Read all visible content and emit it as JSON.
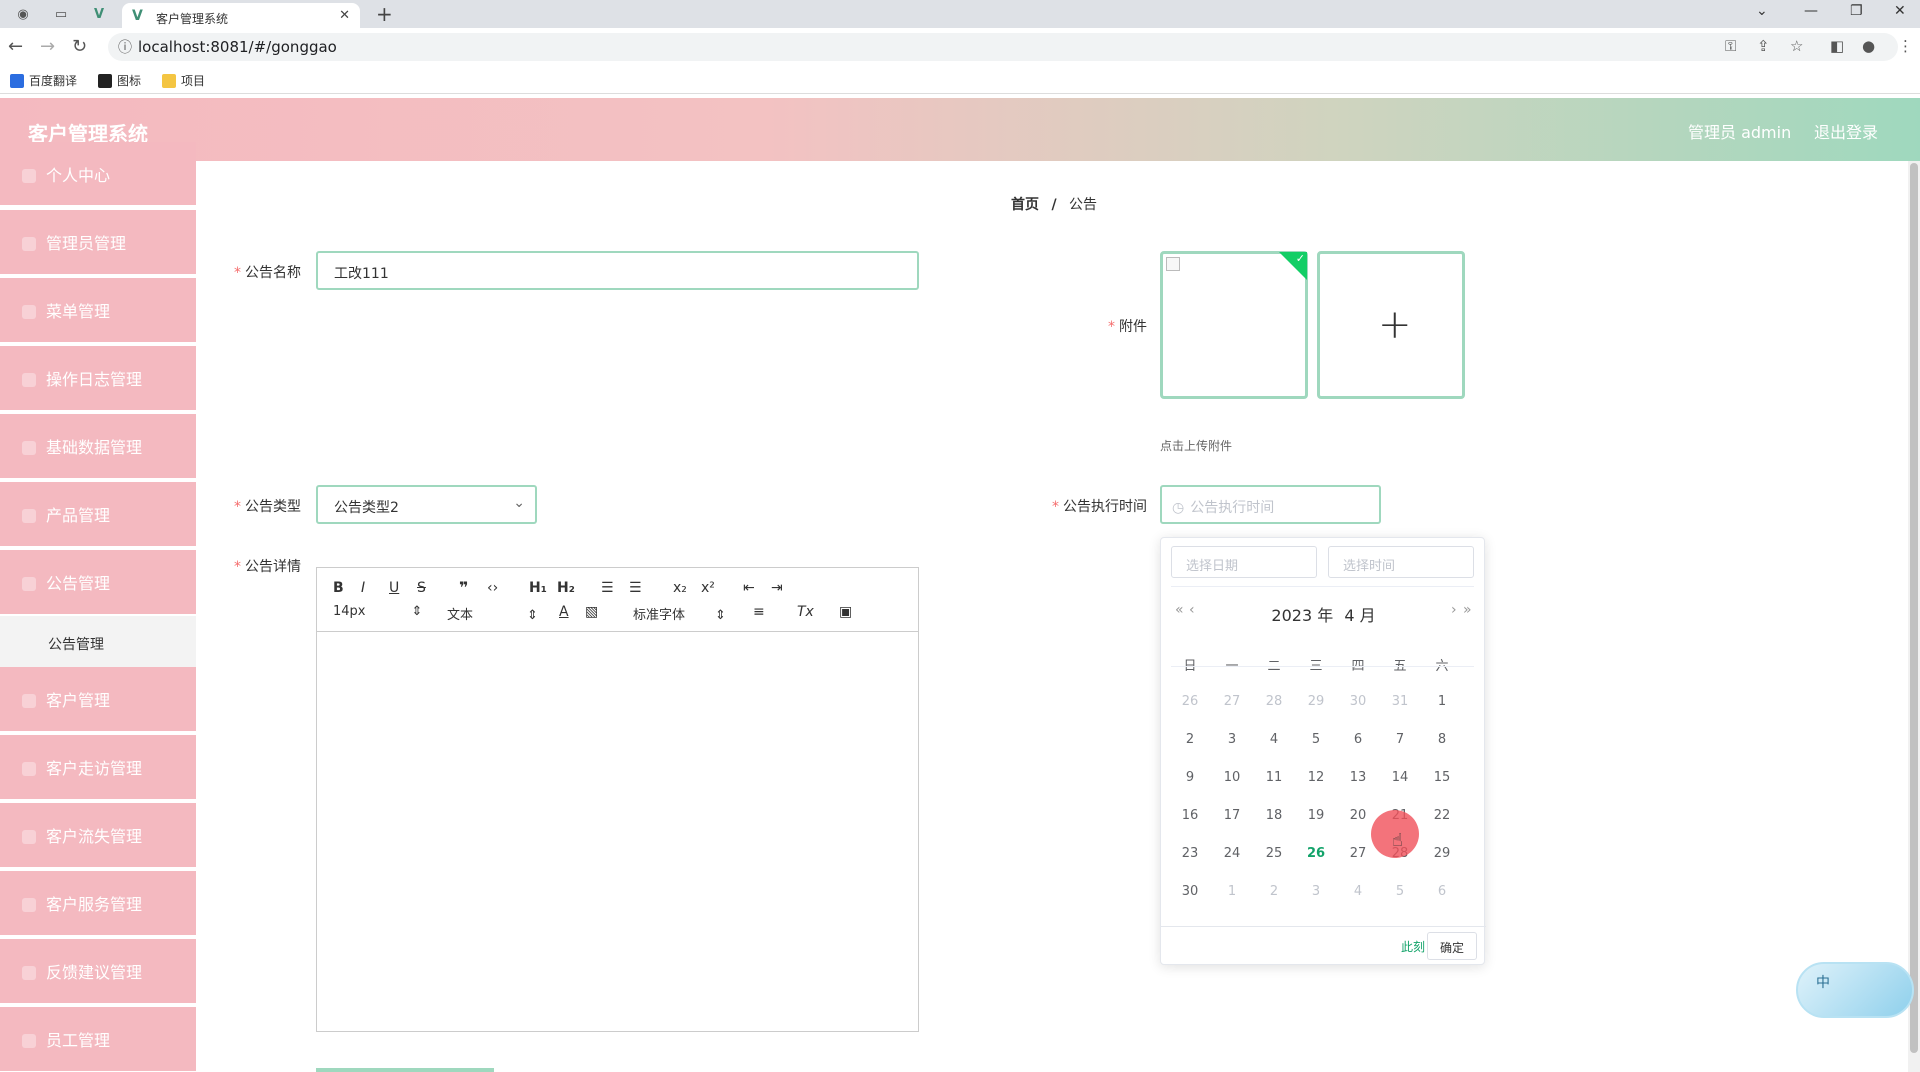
{
  "browser": {
    "tab_title": "客户管理系统",
    "url": "localhost:8081/#/gonggao",
    "bookmarks": [
      {
        "label": "百度翻译",
        "color": "#2b6de0"
      },
      {
        "label": "图标",
        "color": "#222222"
      },
      {
        "label": "项目",
        "color": "#f4c542"
      }
    ]
  },
  "header": {
    "title": "客户管理系统",
    "user": "管理员 admin",
    "logout": "退出登录"
  },
  "sidebar": {
    "items": [
      {
        "label": "个人中心"
      },
      {
        "label": "管理员管理"
      },
      {
        "label": "菜单管理"
      },
      {
        "label": "操作日志管理"
      },
      {
        "label": "基础数据管理"
      },
      {
        "label": "产品管理"
      },
      {
        "label": "公告管理"
      },
      {
        "label": "客户管理"
      },
      {
        "label": "客户走访管理"
      },
      {
        "label": "客户流失管理"
      },
      {
        "label": "客户服务管理"
      },
      {
        "label": "反馈建议管理"
      },
      {
        "label": "员工管理"
      }
    ],
    "active_sub": "公告管理"
  },
  "breadcrumb": {
    "home": "首页",
    "sep": "/",
    "current": "公告"
  },
  "form": {
    "name_label": "公告名称",
    "name_value": "工改111",
    "attachment_label": "附件",
    "upload_hint": "点击上传附件",
    "type_label": "公告类型",
    "type_value": "公告类型2",
    "time_label": "公告执行时间",
    "time_placeholder": "公告执行时间",
    "detail_label": "公告详情"
  },
  "editor": {
    "font_size": "14px",
    "text_style": "文本",
    "font_family": "标准字体"
  },
  "datepicker": {
    "date_placeholder": "选择日期",
    "time_placeholder": "选择时间",
    "year": "2023 年",
    "month": "4 月",
    "weekdays": [
      "日",
      "一",
      "二",
      "三",
      "四",
      "五",
      "六"
    ],
    "weeks": [
      [
        {
          "d": "26",
          "dim": true
        },
        {
          "d": "27",
          "dim": true
        },
        {
          "d": "28",
          "dim": true
        },
        {
          "d": "29",
          "dim": true
        },
        {
          "d": "30",
          "dim": true
        },
        {
          "d": "31",
          "dim": true
        },
        {
          "d": "1"
        }
      ],
      [
        {
          "d": "2"
        },
        {
          "d": "3"
        },
        {
          "d": "4"
        },
        {
          "d": "5"
        },
        {
          "d": "6"
        },
        {
          "d": "7"
        },
        {
          "d": "8"
        }
      ],
      [
        {
          "d": "9"
        },
        {
          "d": "10"
        },
        {
          "d": "11"
        },
        {
          "d": "12"
        },
        {
          "d": "13"
        },
        {
          "d": "14"
        },
        {
          "d": "15"
        }
      ],
      [
        {
          "d": "16"
        },
        {
          "d": "17"
        },
        {
          "d": "18"
        },
        {
          "d": "19"
        },
        {
          "d": "20"
        },
        {
          "d": "21"
        },
        {
          "d": "22"
        }
      ],
      [
        {
          "d": "23"
        },
        {
          "d": "24"
        },
        {
          "d": "25"
        },
        {
          "d": "26",
          "today": true
        },
        {
          "d": "27"
        },
        {
          "d": "28"
        },
        {
          "d": "29"
        }
      ],
      [
        {
          "d": "30"
        },
        {
          "d": "1",
          "dim": true
        },
        {
          "d": "2",
          "dim": true
        },
        {
          "d": "3",
          "dim": true
        },
        {
          "d": "4",
          "dim": true
        },
        {
          "d": "5",
          "dim": true
        },
        {
          "d": "6",
          "dim": true
        }
      ]
    ],
    "now_label": "此刻",
    "ok_label": "确定"
  },
  "ime": {
    "label": "中"
  },
  "colors": {
    "header_left": "#f4b9c0",
    "header_right": "#9fd8be",
    "sidebar": "#f4b9c0",
    "input_border": "#9fd8be",
    "today": "#13a36a"
  }
}
